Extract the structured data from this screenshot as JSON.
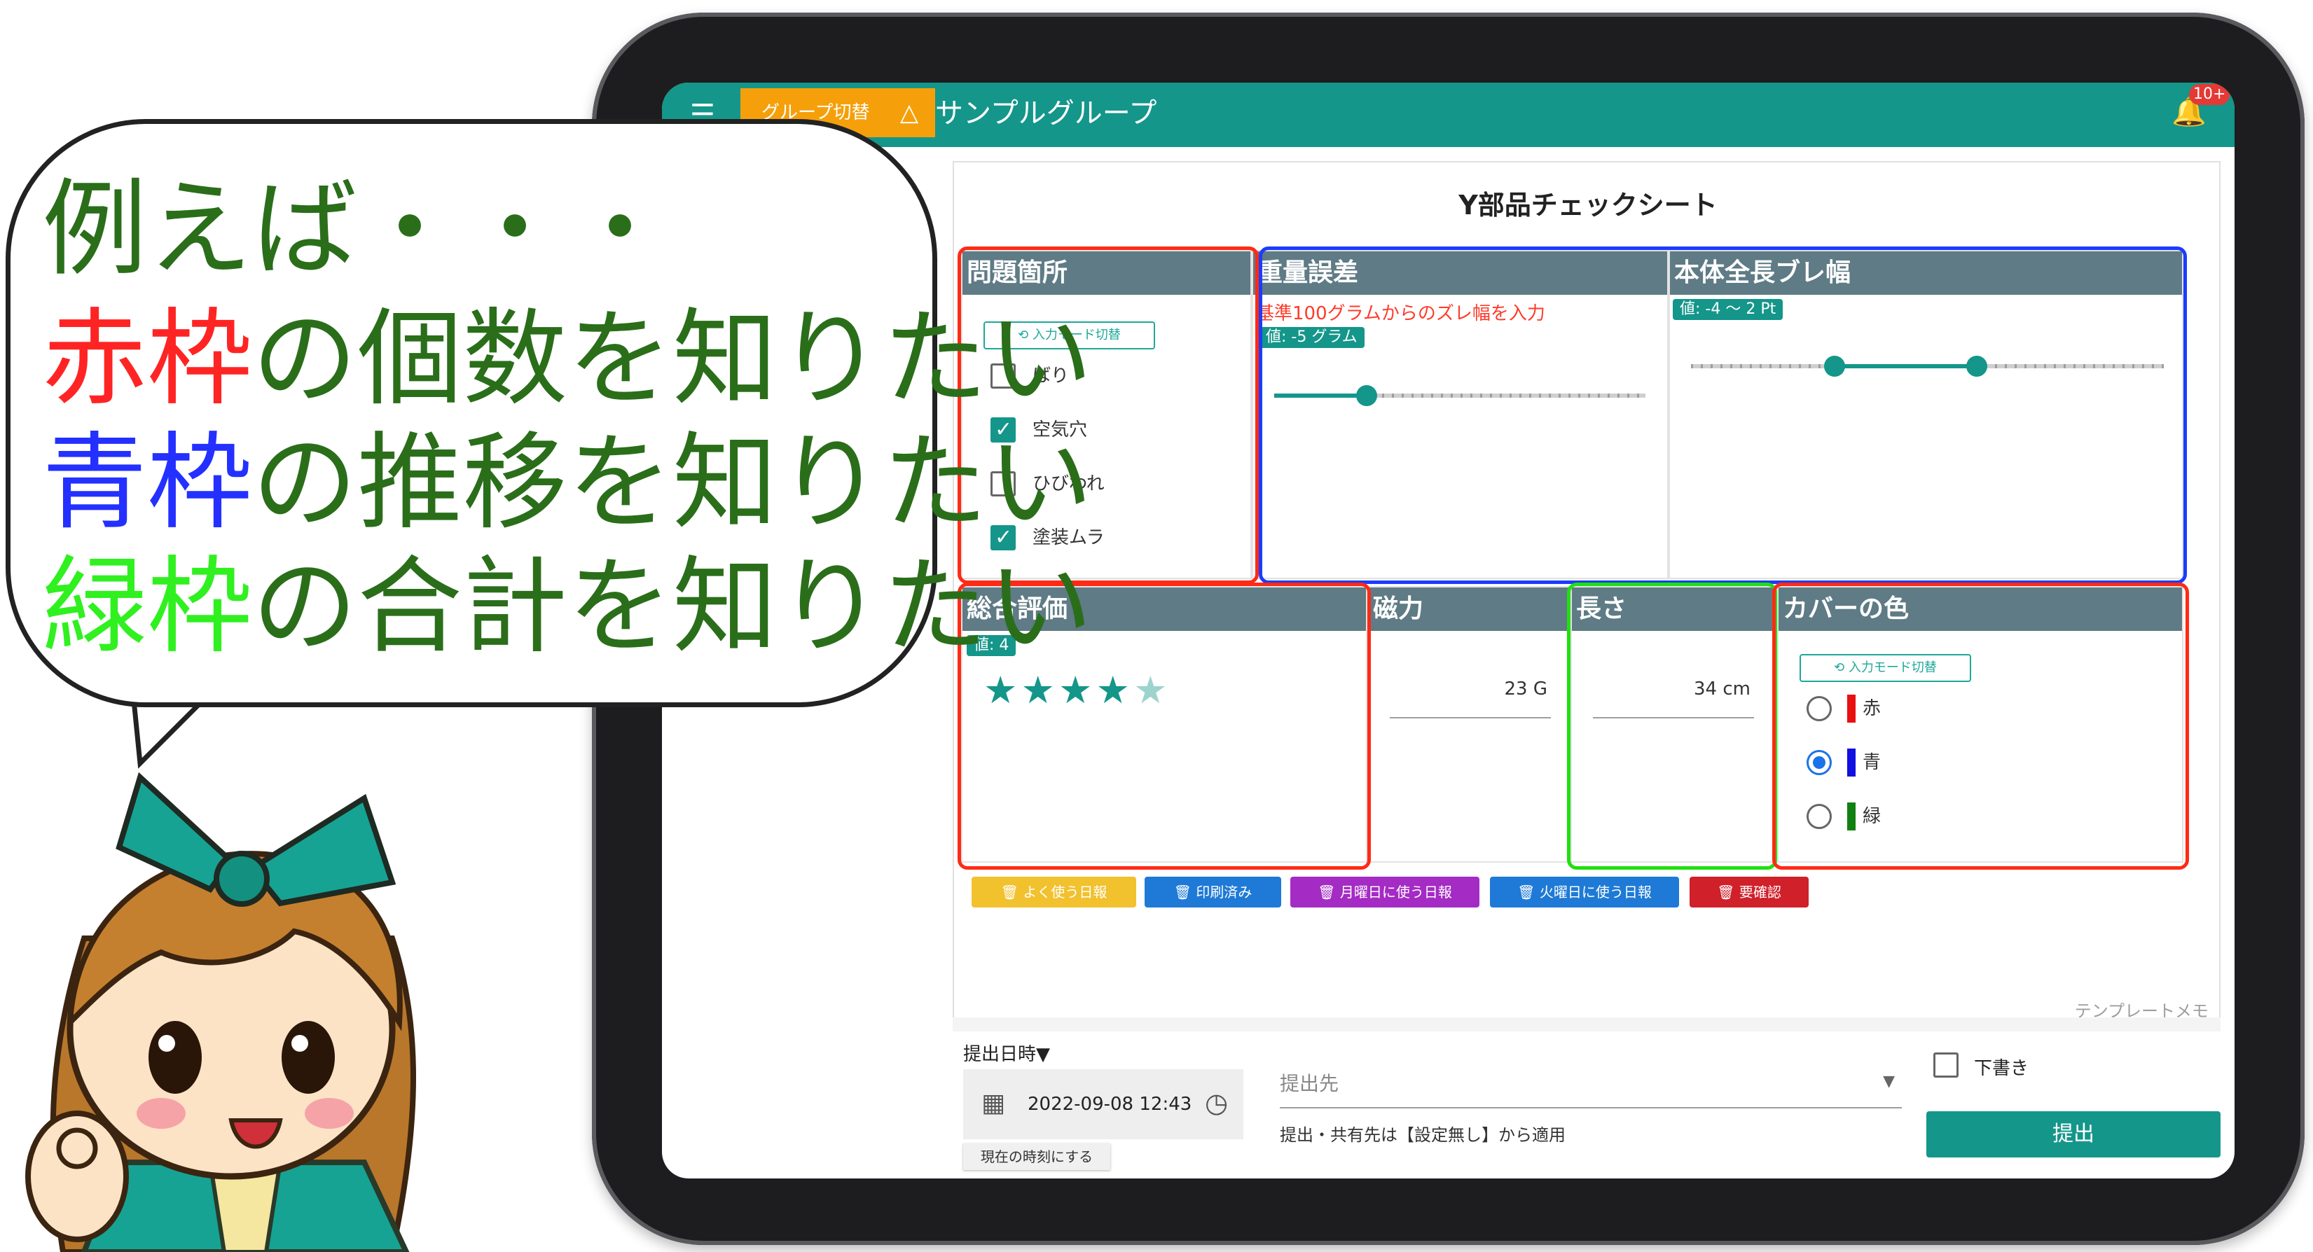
{
  "app": {
    "menu_icon": "menu-icon",
    "group_switch_label": "グループ切替",
    "warning_icon": "warning-triangle-icon",
    "group_name": "サンプルグループ",
    "notification_icon": "bell-icon",
    "notification_count": "10+"
  },
  "sheet": {
    "title": "Y部品チェックシート",
    "problem": {
      "header": "問題箇所",
      "mode_switch": "入力モード切替",
      "options": [
        {
          "label": "ばり",
          "checked": false
        },
        {
          "label": "空気穴",
          "checked": true
        },
        {
          "label": "ひびわれ",
          "checked": false
        },
        {
          "label": "塗装ムラ",
          "checked": true
        }
      ]
    },
    "weight": {
      "header": "重量誤差",
      "hint": "基準100グラムからのズレ幅を入力",
      "value_chip": "値: -5 グラム"
    },
    "length_range": {
      "header": "本体全長ブレ幅",
      "value_chip": "値: -4 〜 2 Pt"
    },
    "overall": {
      "header": "総合評価",
      "value_chip": "値: 4",
      "rating": 4,
      "max": 5
    },
    "magnetic": {
      "header": "磁力",
      "value": "23 G"
    },
    "length": {
      "header": "長さ",
      "value": "34 cm"
    },
    "cover_color": {
      "header": "カバーの色",
      "mode_switch": "入力モード切替",
      "options": [
        {
          "label": "赤",
          "color": "#e81010",
          "selected": false
        },
        {
          "label": "青",
          "color": "#1010e0",
          "selected": true
        },
        {
          "label": "緑",
          "color": "#108010",
          "selected": false
        }
      ]
    },
    "tags": [
      {
        "label": "よく使う日報",
        "color": "#f2c12e"
      },
      {
        "label": "印刷済み",
        "color": "#1e7ad6"
      },
      {
        "label": "月曜日に使う日報",
        "color": "#a42bc4"
      },
      {
        "label": "火曜日に使う日報",
        "color": "#1e7ad6"
      },
      {
        "label": "要確認",
        "color": "#d0202a"
      }
    ],
    "template_memo": "テンプレートメモ"
  },
  "footer": {
    "submit_datetime_label": "提出日時▼",
    "datetime_value": "2022-09-08 12:43",
    "set_now_button": "現在の時刻にする",
    "destination_placeholder": "提出先",
    "destination_note": "提出・共有先は【設定無し】から適用",
    "draft_label": "下書き",
    "submit_button": "提出"
  },
  "bubble": {
    "line1": "例えば・・・",
    "line2_highlight": "赤枠",
    "line2_rest": "の個数を知りたい",
    "line3_highlight": "青枠",
    "line3_rest": "の推移を知りたい",
    "line4_highlight": "緑枠",
    "line4_rest": "の合計を知りたい"
  }
}
